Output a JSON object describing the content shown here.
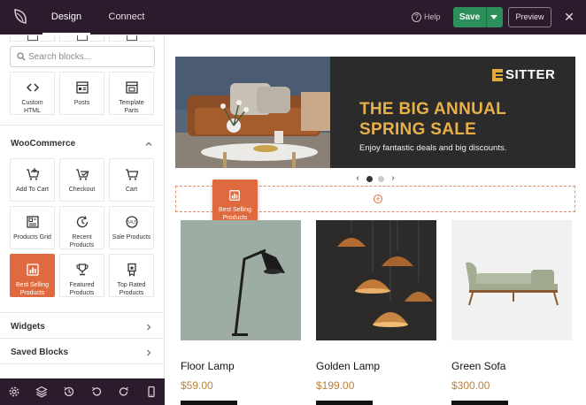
{
  "topbar": {
    "tabs": [
      {
        "label": "Design",
        "active": true
      },
      {
        "label": "Connect",
        "active": false
      }
    ],
    "help_label": "Help",
    "save_label": "Save",
    "preview_label": "Preview",
    "close_glyph": "✕"
  },
  "sidebar": {
    "search_placeholder": "Search blocks...",
    "top_blocks": [
      {
        "label": "Custom HTML",
        "icon": "code-icon"
      },
      {
        "label": "Posts",
        "icon": "posts-icon"
      },
      {
        "label": "Template Parts",
        "icon": "template-parts-icon"
      }
    ],
    "woocommerce": {
      "title": "WooCommerce",
      "blocks": [
        {
          "label": "Add To Cart",
          "icon": "add-to-cart-icon"
        },
        {
          "label": "Checkout",
          "icon": "checkout-icon"
        },
        {
          "label": "Cart",
          "icon": "cart-icon"
        },
        {
          "label": "Products Grid",
          "icon": "products-grid-icon"
        },
        {
          "label": "Recent Products",
          "icon": "recent-products-icon"
        },
        {
          "label": "Sale Products",
          "icon": "sale-products-icon"
        },
        {
          "label": "Best Selling Products",
          "icon": "best-selling-icon",
          "active": true
        },
        {
          "label": "Featured Products",
          "icon": "trophy-icon"
        },
        {
          "label": "Top Rated Products",
          "icon": "top-rated-icon"
        }
      ]
    },
    "sections": [
      {
        "label": "Widgets"
      },
      {
        "label": "Saved Blocks"
      }
    ],
    "bottom_icons": [
      "settings-icon",
      "layers-icon",
      "history-icon",
      "undo-icon",
      "redo-icon",
      "mobile-preview-icon"
    ]
  },
  "canvas": {
    "banner": {
      "brand": "SITTER",
      "headline": "THE BIG ANNUAL SPRING SALE",
      "subtext": "Enjoy fantastic deals and big discounts."
    },
    "slider": {
      "prev": "‹",
      "next": "›",
      "slides": 2,
      "current": 1
    },
    "drag_ghost_label": "Best Selling Products",
    "products": [
      {
        "name": "Floor Lamp",
        "price": "$59.00"
      },
      {
        "name": "Golden Lamp",
        "price": "$199.00"
      },
      {
        "name": "Green Sofa",
        "price": "$300.00"
      }
    ]
  },
  "colors": {
    "topbar": "#2c1b2c",
    "accent": "#e06a3f",
    "save_green": "#2c8f5a",
    "price_gold": "#b8823a",
    "banner_gold": "#e8b04a"
  }
}
